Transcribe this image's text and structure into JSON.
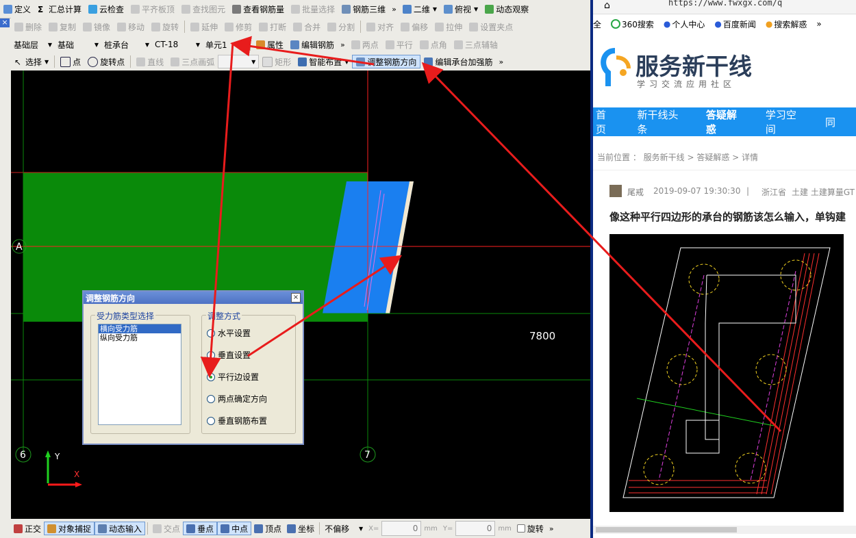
{
  "app": {
    "close_x": "×",
    "toolbar1": [
      "定义",
      "汇总计算",
      "云检查",
      "平齐板顶",
      "查找图元",
      "查看钢筋量",
      "批量选择",
      "钢筋三维",
      "二维",
      "俯视",
      "动态观察"
    ],
    "toolbar2": [
      "删除",
      "复制",
      "镜像",
      "移动",
      "旋转",
      "延伸",
      "修剪",
      "打断",
      "合并",
      "分割",
      "对齐",
      "偏移",
      "拉伸",
      "设置夹点"
    ],
    "toolbar3": {
      "floor": "基础层",
      "cat": "基础",
      "type": "桩承台",
      "id": "CT-18",
      "unit": "单元1",
      "prop": "属性",
      "edit": "编辑钢筋",
      "two_points": "两点",
      "parallel": "平行",
      "angle": "点角",
      "three_axis": "三点辅轴"
    },
    "toolbar4": {
      "select": "选择",
      "point": "点",
      "rotate_point": "旋转点",
      "line": "直线",
      "arc": "三点画弧",
      "rect": "矩形",
      "smart": "智能布置",
      "adjust": "调整钢筋方向",
      "edit_cap": "编辑承台加强筋"
    },
    "more": "»",
    "canvas": {
      "axis_a": "A",
      "axis_6": "6",
      "axis_7": "7",
      "dim": "7800",
      "y": "Y",
      "x": "X"
    },
    "dialog": {
      "title": "调整钢筋方向",
      "close": "×",
      "group1": "受力筋类型选择",
      "items": [
        "横向受力筋",
        "纵向受力筋"
      ],
      "group2": "调整方式",
      "options": [
        "水平设置",
        "垂直设置",
        "平行边设置",
        "两点确定方向",
        "垂直钢筋布置"
      ],
      "selected_option": "平行边设置"
    },
    "status": {
      "ortho": "正交",
      "snap": "对象捕捉",
      "dyn": "动态输入",
      "cross": "交点",
      "perp": "垂点",
      "mid": "中点",
      "vertex": "顶点",
      "coord": "坐标",
      "offset": "不偏移",
      "xl": "X=",
      "xv": "0",
      "mm1": "mm",
      "yl": "Y=",
      "yv": "0",
      "mm2": "mm",
      "rotate": "旋转"
    }
  },
  "browser": {
    "url": "https://www.fwxgx.com/q",
    "bookmarks": [
      "全",
      "360搜索",
      "个人中心",
      "百度新闻",
      "搜索解惑"
    ],
    "logo_title": "服务新干线",
    "logo_sub": "学习交流应用社区",
    "nav": [
      "首页",
      "新干线头条",
      "答疑解惑",
      "学习空间",
      "同"
    ],
    "breadcrumb": "当前位置 ： 服务新干线 > 答疑解惑 > 详情",
    "author": "尾戒",
    "date": "2019-09-07 19:30:30",
    "sep": "|",
    "region": "浙江省",
    "tags": "土建 土建算量GT",
    "question": "像这种平行四边形的承台的钢筋该怎么输入，单钩建"
  },
  "colors": {
    "accent": "#1a92f0",
    "green": "#008000",
    "blue": "#1a7ff0",
    "arrow": "#e81c1c"
  }
}
